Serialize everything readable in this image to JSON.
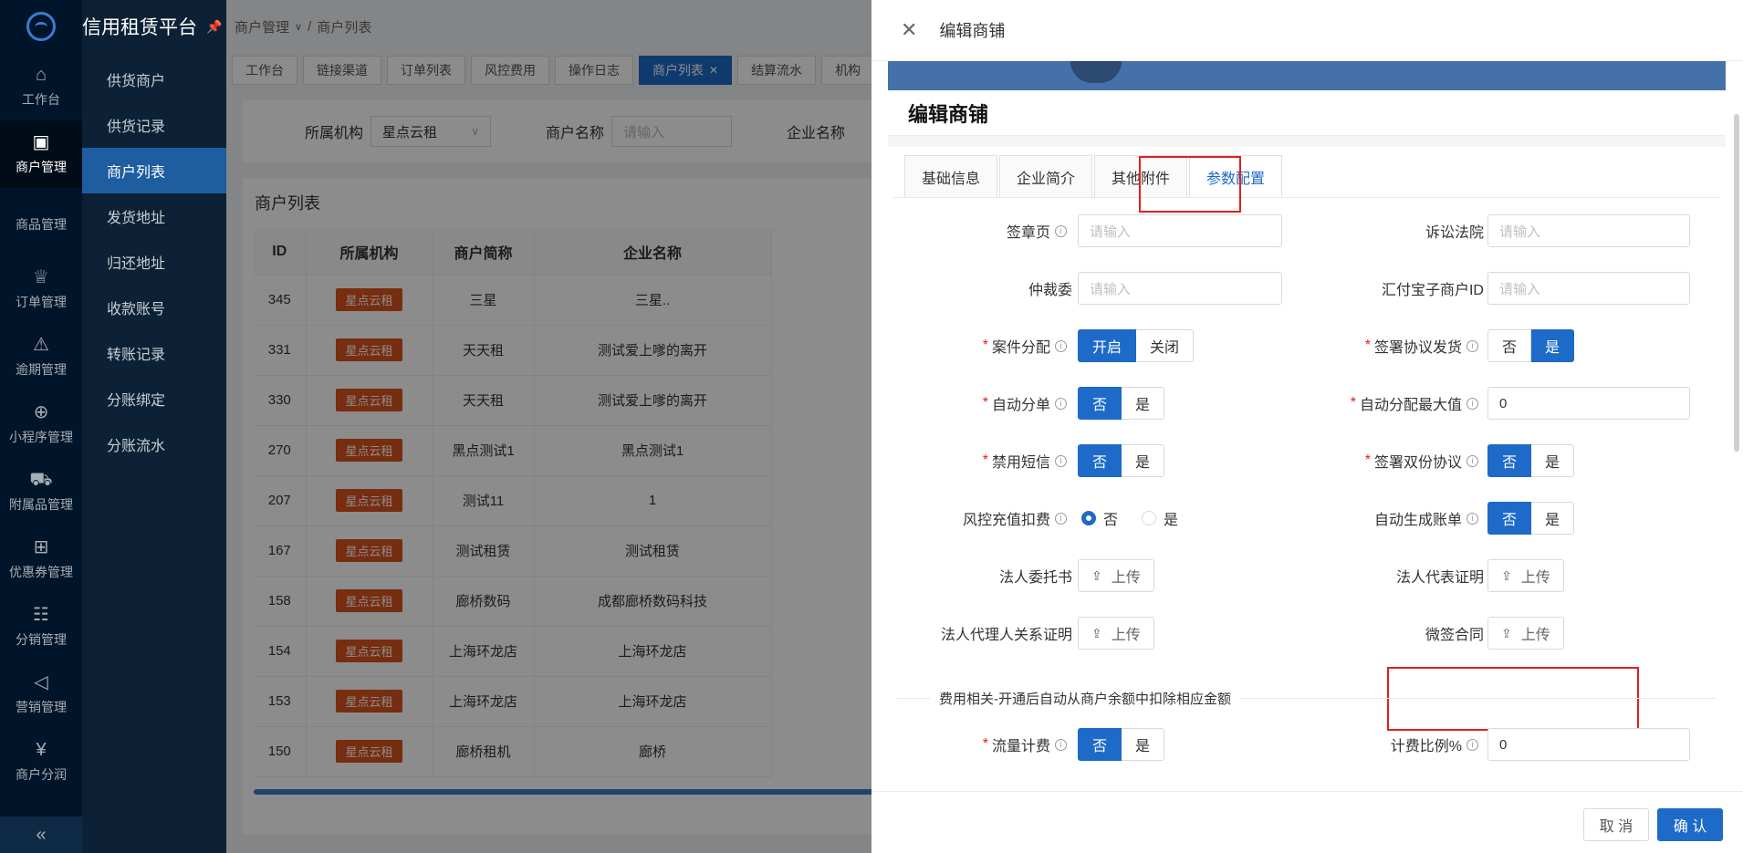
{
  "app": {
    "title": "信用租赁平台"
  },
  "rail": {
    "items": [
      {
        "label": "工作台",
        "icon": "home-icon",
        "glyph": "⌂"
      },
      {
        "label": "商户管理",
        "icon": "shop-bag-icon",
        "glyph": "▣"
      },
      {
        "label": "商品管理",
        "icon": "apple-icon",
        "glyph": ""
      },
      {
        "label": "订单管理",
        "icon": "trophy-icon",
        "glyph": "♕"
      },
      {
        "label": "逾期管理",
        "icon": "alarm-icon",
        "glyph": "⚠"
      },
      {
        "label": "小程序管理",
        "icon": "android-icon",
        "glyph": "⊕"
      },
      {
        "label": "附属品管理",
        "icon": "cart-icon",
        "glyph": "⛟"
      },
      {
        "label": "优惠券管理",
        "icon": "gift-icon",
        "glyph": "⊞"
      },
      {
        "label": "分销管理",
        "icon": "sliders-icon",
        "glyph": "☷"
      },
      {
        "label": "营销管理",
        "icon": "megaphone-icon",
        "glyph": "◁"
      },
      {
        "label": "商户分润",
        "icon": "yen-icon",
        "glyph": "¥"
      }
    ],
    "collapse_glyph": "«"
  },
  "submenu": {
    "items": [
      "供货商户",
      "供货记录",
      "商户列表",
      "发货地址",
      "归还地址",
      "收款账号",
      "转账记录",
      "分账绑定",
      "分账流水"
    ]
  },
  "breadcrumb": {
    "parent": "商户管理",
    "sep": "/",
    "current": "商户列表"
  },
  "tag_tabs": [
    "工作台",
    "链接渠道",
    "订单列表",
    "风控费用",
    "操作日志",
    "商户列表",
    "结算流水",
    "机构"
  ],
  "filters": {
    "org_label": "所属机构",
    "org_value": "星点云租",
    "merchant_label": "商户名称",
    "merchant_placeholder": "请输入",
    "company_label": "企业名称"
  },
  "list": {
    "title": "商户列表",
    "columns": [
      "ID",
      "所属机构",
      "商户简称",
      "企业名称"
    ],
    "rows": [
      {
        "id": "345",
        "org": "星点云租",
        "short": "三星",
        "company": "三星.."
      },
      {
        "id": "331",
        "org": "星点云租",
        "short": "天天租",
        "company": "测试爱上嗲的离开"
      },
      {
        "id": "330",
        "org": "星点云租",
        "short": "天天租",
        "company": "测试爱上嗲的离开"
      },
      {
        "id": "270",
        "org": "星点云租",
        "short": "黑点测试1",
        "company": "黑点测试1"
      },
      {
        "id": "207",
        "org": "星点云租",
        "short": "测试11",
        "company": "1"
      },
      {
        "id": "167",
        "org": "星点云租",
        "short": "测试租赁",
        "company": "测试租赁"
      },
      {
        "id": "158",
        "org": "星点云租",
        "short": "廊桥数码",
        "company": "成都廊桥数码科技"
      },
      {
        "id": "154",
        "org": "星点云租",
        "short": "上海环龙店",
        "company": "上海环龙店"
      },
      {
        "id": "153",
        "org": "星点云租",
        "short": "上海环龙店",
        "company": "上海环龙店"
      },
      {
        "id": "150",
        "org": "星点云租",
        "short": "廊桥租机",
        "company": "廊桥"
      }
    ]
  },
  "drawer": {
    "title": "编辑商铺",
    "close_glyph": "✕",
    "store_heading": "编辑商铺",
    "tabs": [
      "基础信息",
      "企业简介",
      "其他附件",
      "参数配置"
    ],
    "active_tab": "参数配置",
    "fields": {
      "seal_page": {
        "label": "签章页",
        "placeholder": "请输入"
      },
      "court": {
        "label": "诉讼法院",
        "placeholder": "请输入"
      },
      "arbitration": {
        "label": "仲裁委",
        "placeholder": "请输入"
      },
      "huifu_id": {
        "label": "汇付宝子商户ID",
        "placeholder": "请输入"
      },
      "case_assign": {
        "label": "案件分配",
        "options": [
          "开启",
          "关闭"
        ],
        "selected": "开启"
      },
      "sign_ship": {
        "label": "签署协议发货",
        "options": [
          "否",
          "是"
        ],
        "selected": "是"
      },
      "auto_split": {
        "label": "自动分单",
        "options": [
          "否",
          "是"
        ],
        "selected": "否"
      },
      "auto_max": {
        "label": "自动分配最大值",
        "value": "0"
      },
      "disable_sms": {
        "label": "禁用短信",
        "options": [
          "否",
          "是"
        ],
        "selected": "否"
      },
      "dual_agreement": {
        "label": "签署双份协议",
        "options": [
          "否",
          "是"
        ],
        "selected": "否"
      },
      "risk_recharge": {
        "label": "风控充值扣费",
        "options": [
          "否",
          "是"
        ],
        "selected": "否"
      },
      "auto_bill": {
        "label": "自动生成账单",
        "options": [
          "否",
          "是"
        ],
        "selected": "否"
      },
      "legal_entrust": {
        "label": "法人委托书",
        "button": "上传"
      },
      "legal_rep_cert": {
        "label": "法人代表证明",
        "button": "上传"
      },
      "agent_relation": {
        "label": "法人代理人关系证明",
        "button": "上传"
      },
      "micro_contract": {
        "label": "微签合同",
        "button": "上传"
      },
      "fee_divider": "费用相关-开通后自动从商户余额中扣除相应金额",
      "traffic_fee": {
        "label": "流量计费",
        "options": [
          "否",
          "是"
        ],
        "selected": "否"
      },
      "fee_ratio": {
        "label": "计费比例%",
        "value": "0"
      }
    },
    "cancel": "取 消",
    "confirm": "确 认"
  },
  "colors": {
    "primary": "#1d6ac9",
    "tag": "#d9531e",
    "highlight": "#e0201c",
    "sidebar": "#001529"
  }
}
